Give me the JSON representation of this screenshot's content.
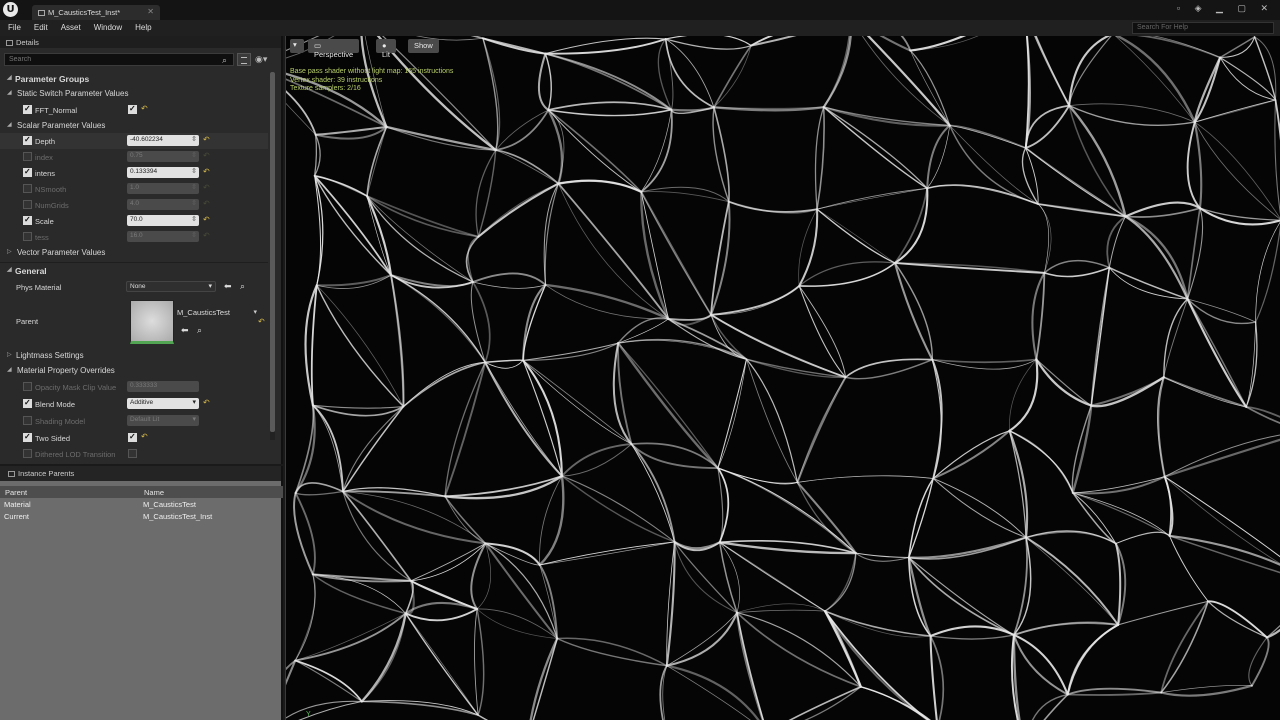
{
  "window": {
    "logo": "U",
    "tab_title": "M_CausticsTest_Inst*",
    "controls": "▫ ◈ ▁ ▢ ✕"
  },
  "menu": [
    "File",
    "Edit",
    "Asset",
    "Window",
    "Help"
  ],
  "help_search_placeholder": "Search For Help",
  "details": {
    "tab_label": "Details",
    "search_placeholder": "Search",
    "parameter_groups": "Parameter Groups",
    "static_switch_header": "Static Switch Parameter Values",
    "static_switches": [
      {
        "name": "FFT_Normal",
        "enabled": true,
        "value": true
      }
    ],
    "scalar_header": "Scalar Parameter Values",
    "scalars": [
      {
        "name": "Depth",
        "enabled": true,
        "value": "-40.602234"
      },
      {
        "name": "index",
        "enabled": false,
        "value": "0.75"
      },
      {
        "name": "intens",
        "enabled": true,
        "value": "0.133394"
      },
      {
        "name": "NSmooth",
        "enabled": false,
        "value": "1.0"
      },
      {
        "name": "NumGrids",
        "enabled": false,
        "value": "4.0"
      },
      {
        "name": "Scale",
        "enabled": true,
        "value": "70.0"
      },
      {
        "name": "tess",
        "enabled": false,
        "value": "16.0"
      }
    ],
    "vector_header": "Vector Parameter Values",
    "general_header": "General",
    "phys_material_label": "Phys Material",
    "phys_material_value": "None",
    "parent_label": "Parent",
    "parent_value": "M_CausticsTest",
    "lightmass_header": "Lightmass Settings",
    "overrides_header": "Material Property Overrides",
    "overrides": {
      "opacity_mask_label": "Opacity Mask Clip Value",
      "opacity_mask_value": "0.333333",
      "blend_mode_label": "Blend Mode",
      "blend_mode_value": "Additive",
      "shading_model_label": "Shading Model",
      "shading_model_value": "Default Lit",
      "two_sided_label": "Two Sided",
      "dithered_label": "Dithered LOD Transition"
    }
  },
  "instance_parents": {
    "tab_label": "Instance Parents",
    "col_parent": "Parent",
    "col_name": "Name",
    "rows": [
      {
        "parent": "Material",
        "name": "M_CausticsTest"
      },
      {
        "parent": "Current",
        "name": "M_CausticsTest_Inst"
      }
    ]
  },
  "viewport": {
    "perspective": "Perspective",
    "lit": "Lit",
    "show": "Show",
    "stats": [
      "Base pass shader without light map: 165 instructions",
      "Vertex shader: 39 instructions",
      "Texture samplers: 2/16"
    ],
    "axis_label": "Y"
  },
  "colors": {
    "accent_reset": "#d4b84a",
    "stats_text": "#b9cf6a",
    "viewport_bg": "#050505",
    "caustic_lines": "#e8e8e8"
  }
}
